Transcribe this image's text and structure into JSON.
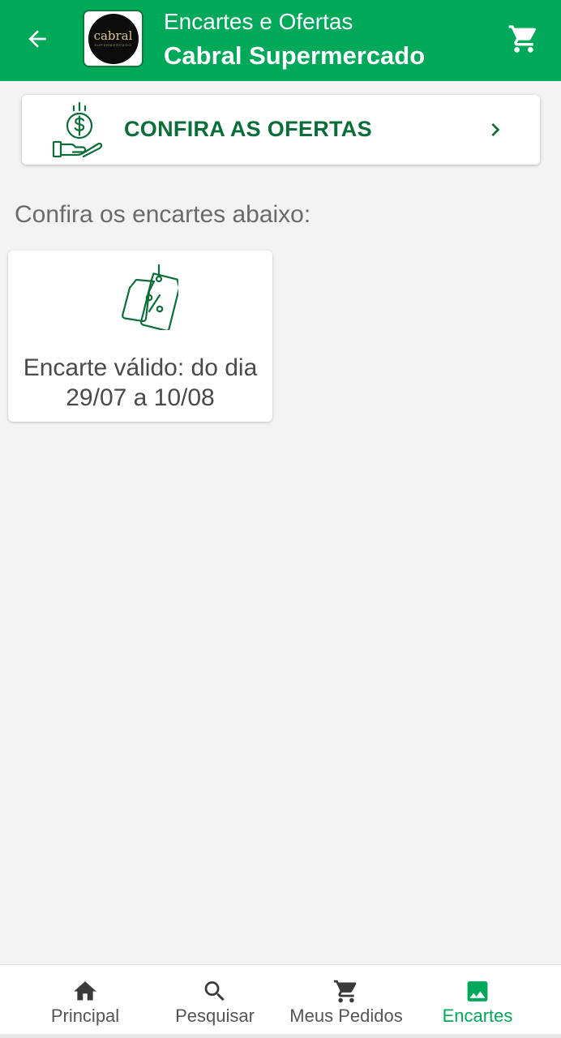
{
  "header": {
    "subtitle": "Encartes e Ofertas",
    "title": "Cabral Supermercado",
    "logo_text": "cabral",
    "logo_sub": "SUPERMERCADO",
    "back_icon": "arrow-left-icon",
    "cart_icon": "cart-icon",
    "color": "#00a859"
  },
  "offers_banner": {
    "label": "CONFIRA AS OFERTAS",
    "icon": "money-hand-icon",
    "chevron_icon": "chevron-right-icon"
  },
  "section_title": "Confira os encartes abaixo:",
  "flyers": [
    {
      "text": "Encarte válido: do dia 29/07 a 10/08",
      "icon": "discount-tag-icon"
    }
  ],
  "bottom_nav": {
    "items": [
      {
        "label": "Principal",
        "icon": "home-icon"
      },
      {
        "label": "Pesquisar",
        "icon": "search-icon"
      },
      {
        "label": "Meus Pedidos",
        "icon": "cart-icon"
      },
      {
        "label": "Encartes",
        "icon": "image-icon",
        "active": true
      }
    ],
    "active_color": "#00a859"
  }
}
